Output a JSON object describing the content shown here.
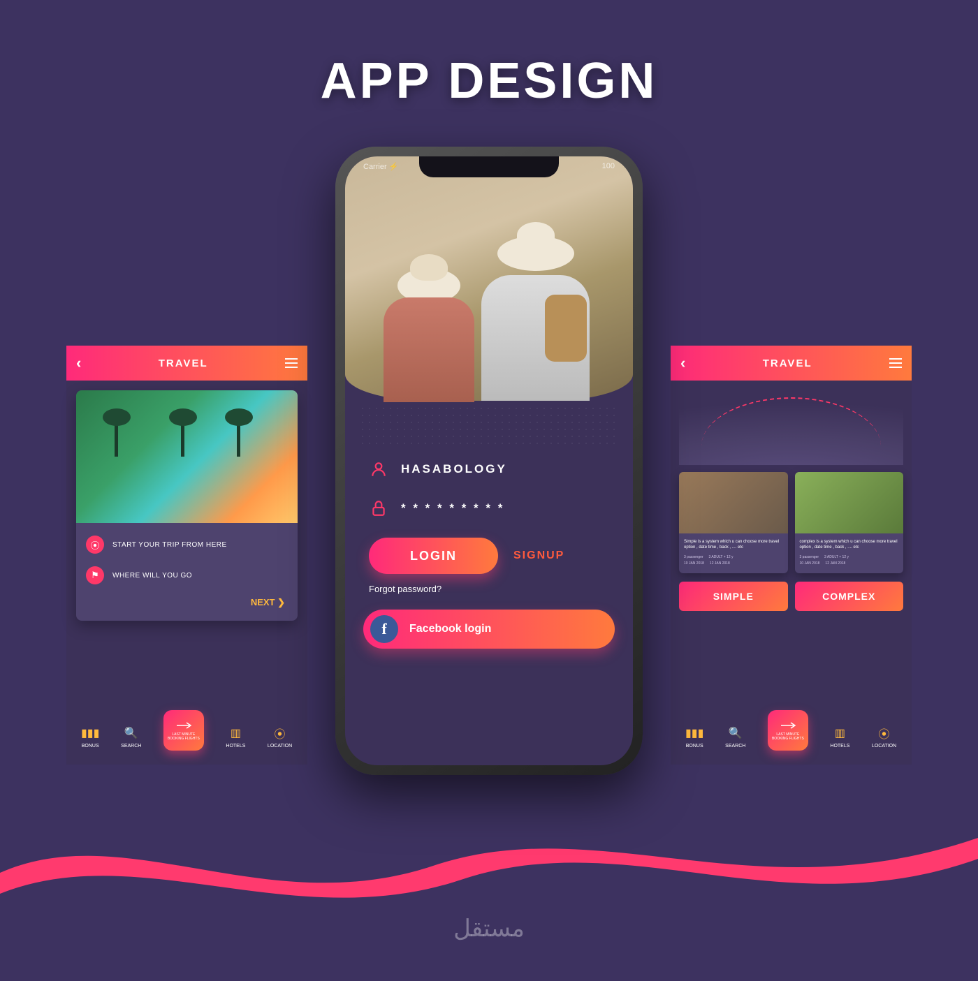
{
  "page_title": "APP DESIGN",
  "watermark": "مستقل",
  "status": {
    "carrier": "Carrier ⚡",
    "battery": "100"
  },
  "left": {
    "header": "TRAVEL",
    "input1": "START YOUR TRIP FROM HERE",
    "input2": "WHERE WILL YOU GO",
    "next": "NEXT ❯"
  },
  "right": {
    "header": "TRAVEL",
    "card1": {
      "desc": "Simple is a system which u can choose more travel option , date time , back , .... etc",
      "passenger": "3 passenger",
      "adult": "3 ADULT + 12 y",
      "date1": "10 JAN 2018",
      "date2": "12 JAN 2018"
    },
    "card2": {
      "desc": "complex is a system which u can choose more travel option , date time , back , .... etc",
      "passenger": "3 passenger",
      "adult": "3 ADULT + 12 y",
      "date1": "10 JAN 2018",
      "date2": "12 JAN 2018"
    },
    "btn_simple": "SIMPLE",
    "btn_complex": "COMPLEX"
  },
  "login": {
    "username": "HASABOLOGY",
    "password": "* * * * * * * * *",
    "login_btn": "LOGIN",
    "signup": "SIGNUP",
    "forgot": "Forgot password?",
    "facebook": "Facebook login"
  },
  "nav": {
    "bonus": "BONUS",
    "search": "SEARCH",
    "center1": "LAST MINUTE",
    "center2": "BOOKING FLIGHTS",
    "hotels": "HOTELS",
    "location": "LOCATION"
  }
}
